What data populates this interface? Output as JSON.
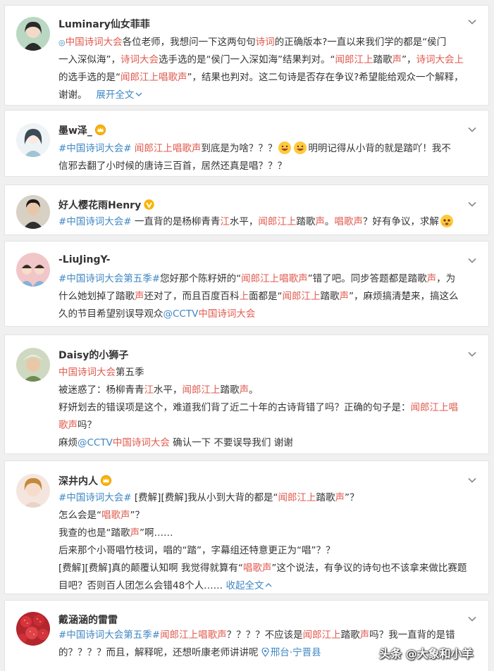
{
  "colors": {
    "topic": "#e05a4e",
    "link": "#3f87c3",
    "highlight": "#eb7350",
    "background": "#f0f0f0"
  },
  "posts": [
    {
      "user": "Luminary仙女菲菲",
      "lines": [
        {
          "a": "中国诗词大会",
          "b": "各位老师，我想问一下这两句句",
          "c": "诗词",
          "d": "的正确版本?一直以来我们学的都是“侯门"
        },
        {
          "a": "一入深似海”，",
          "b": "诗词大会",
          "c": "选手选的是“侯门一入深如海”结果判对。“",
          "d": "闻郎江上",
          "e": "踏歌",
          "f": "声",
          "g": "”，",
          "h": "诗词大会上"
        },
        {
          "a": "的选手选的是“",
          "b": "闻郎江上唱歌声",
          "c": "”，结果也判对。这二句诗是否存在争议?希望能给观众一个解释，"
        },
        {
          "a": "谢谢。",
          "b": "展开全文"
        }
      ]
    },
    {
      "user": "墨w泽_",
      "lines": [
        {
          "a": "#中国诗词大会#",
          "b": "闻郎江上唱歌声",
          "c": "到底是为啥？？？",
          "d": "明明记得从小背的就是踏吖！我不"
        },
        {
          "a": "信邪去翻了小时候的唐诗三百首，居然还真是唱？？？"
        }
      ]
    },
    {
      "user": "好人樱花雨Henry",
      "lines": [
        {
          "a": "#中国诗词大会#",
          "b": "一直背的是杨柳青青",
          "c": "江",
          "d": "水平，",
          "e": "闻郎江上",
          "f": "踏歌",
          "g": "声",
          "h": "。",
          "i": "唱歌声",
          "j": "？好有争议，求解"
        }
      ]
    },
    {
      "user": "-LiuJingY-",
      "lines": [
        {
          "a": "#中国诗词大会第五季#",
          "b": "您好那个陈籽妍的“",
          "c": "闻郎江上唱歌声",
          "d": "”错了吧。同步答题都是踏歌",
          "e": "声",
          "f": "，为"
        },
        {
          "a": "什么她划掉了踏歌",
          "b": "声",
          "c": "还对了，而且百度百科",
          "d": "上",
          "e": "面都是“",
          "f": "闻郎江上",
          "g": "踏歌",
          "h": "声",
          "i": "”，麻烦搞清楚来，搞这么"
        },
        {
          "a": "久的节目希望别误导观众",
          "b": "@CCTV",
          "c": "中国诗词大会"
        }
      ]
    },
    {
      "user": "Daisy的小狮子",
      "lines": [
        {
          "a": "中国诗词大会",
          "b": "第五季"
        },
        {
          "a": "被迷惑了：杨柳青青",
          "b": "江",
          "c": "水平，",
          "d": "闻郎江上",
          "e": "踏歌",
          "f": "声",
          "g": "。"
        },
        {
          "a": "籽妍划去的错误项是这个，难道我们背了近二十年的古诗背错了吗？正确的句子是：",
          "b": "闻郎江上唱"
        },
        {
          "a": "歌声",
          "b": "吗？"
        },
        {
          "a": "麻烦",
          "b": "@CCTV",
          "c": "中国诗词大会",
          "d": " 确认一下 不要误导我们 谢谢"
        }
      ]
    },
    {
      "user": "深井内人",
      "lines": [
        {
          "a": "#中国诗词大会#",
          "b": " [费解][费解]我从小到大背的都是“",
          "c": "闻郎江上",
          "d": "踏歌",
          "e": "声",
          "f": "”？"
        },
        {
          "a": "怎么会是“",
          "b": "唱歌声",
          "c": "”？"
        },
        {
          "a": "我查的也是“踏歌",
          "b": "声",
          "c": "”啊……"
        },
        {
          "a": "后来那个小哥唱竹枝词，唱的“踏”，字幕组还特意更正为“唱”？？"
        },
        {
          "a": "[费解][费解]真的颠覆认知啊 我觉得就算有“",
          "b": "唱歌声",
          "c": "”这个说法，有争议的诗句也不该拿来做比赛题"
        },
        {
          "a": "目吧？否则百人团怎么会错48个人…… ",
          "b": "收起全文"
        }
      ]
    },
    {
      "user": "戴涵涵的雷雷",
      "lines": [
        {
          "a": "#中国诗词大会第五季#",
          "b": "闻郎江上唱歌声",
          "c": "？？？？不应该是",
          "d": "闻郎江上",
          "e": "踏歌",
          "f": "声",
          "g": "吗？我一直背的是错"
        },
        {
          "a": "的？？？？而且，解释呢，还想听康老师讲讲呢 ",
          "b": "邢台·宁晋县"
        }
      ]
    }
  ],
  "watermark": "头条 @大象和小羊"
}
